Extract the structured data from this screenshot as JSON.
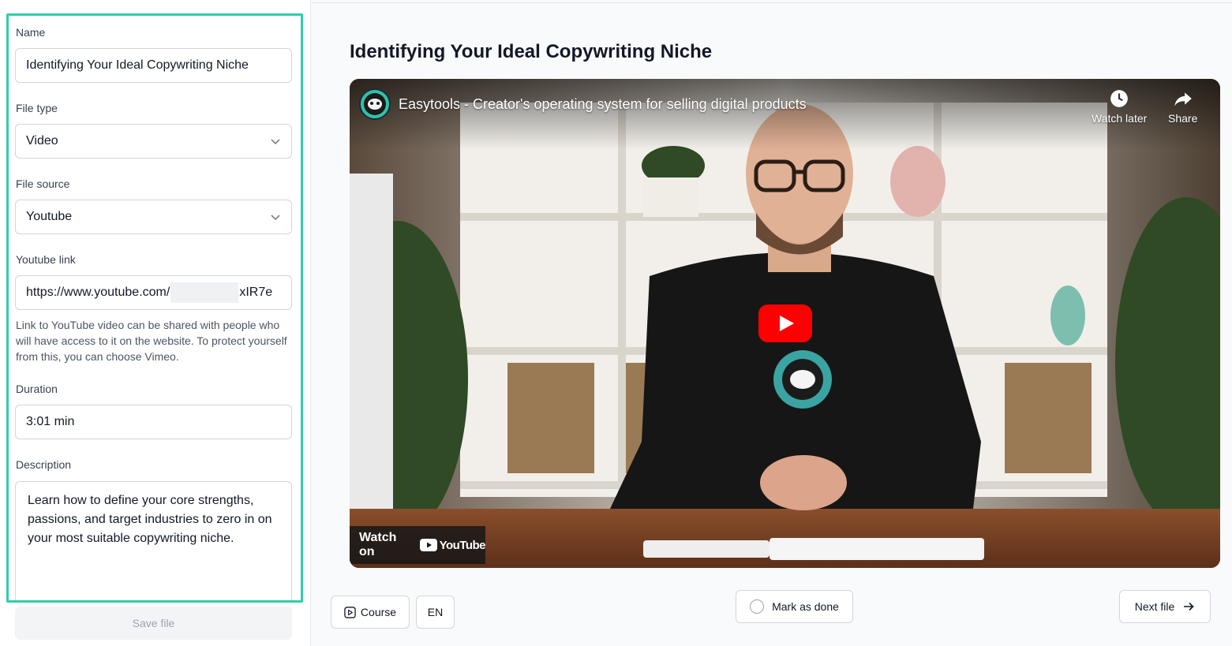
{
  "form": {
    "name_label": "Name",
    "name_value": "Identifying Your Ideal Copywriting Niche",
    "file_type_label": "File type",
    "file_type_value": "Video",
    "file_source_label": "File source",
    "file_source_value": "Youtube",
    "youtube_link_label": "Youtube link",
    "youtube_link_prefix": "https://www.youtube.com/",
    "youtube_link_suffix": "xIR7e",
    "youtube_link_help": "Link to YouTube video can be shared with people who will have access to it on the website. To protect yourself from this, you can choose Vimeo.",
    "duration_label": "Duration",
    "duration_value": "3:01 min",
    "description_label": "Description",
    "description_value": "Learn how to define your core strengths, passions, and target industries to zero in on your most suitable copywriting niche.",
    "save_label": "Save file"
  },
  "main": {
    "title": "Identifying Your Ideal Copywriting Niche"
  },
  "video": {
    "channel_title": "Easytools - Creator's operating system for selling digital products",
    "watch_later_label": "Watch later",
    "share_label": "Share",
    "watch_on_label": "Watch on",
    "youtube_logo_text": "YouTube"
  },
  "controls": {
    "course_label": "Course",
    "language_label": "EN",
    "mark_done_label": "Mark as done",
    "next_file_label": "Next file"
  },
  "colors": {
    "frame_accent": "#2ecfa8",
    "youtube_red": "#ff0000"
  }
}
